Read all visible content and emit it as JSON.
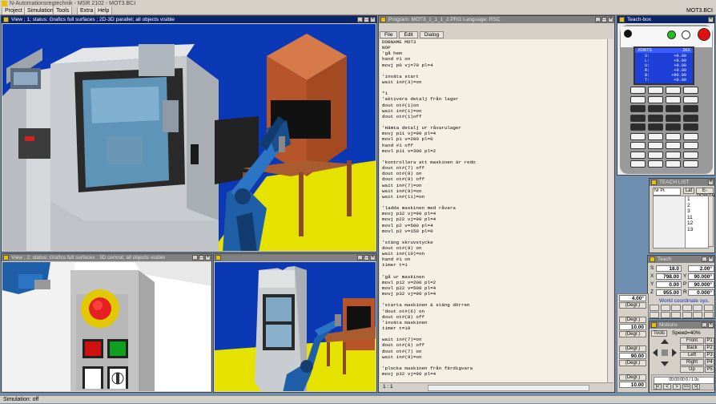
{
  "app": {
    "title": "N-Automationsregtechnik - MSR 2102 - MOT3.BCI",
    "title_right": "MOT3.BCI",
    "menu": [
      "Project",
      "Simulation",
      "Tools",
      "Extra",
      "Help"
    ],
    "menu_right": "MOT3.BCI"
  },
  "view1": {
    "title": "View  ; 1;  status: Grafics   full surfaces ; 2D-3D parallel; all objects visible"
  },
  "view2": {
    "title": "View  ; 2;  status: Grafics   full surfaces ; 3D central; all objects visible"
  },
  "view3": {
    "title": ""
  },
  "program": {
    "title": "Program: MOT3_1_1_1_2.PRG Language: RSC",
    "tabs": [
      "File",
      "Edit",
      "Dialog"
    ],
    "lines": [
      "DOBNAME MOT3",
      "NOP",
      "'gå hem",
      "hand #1 on",
      "movj p0 vj=70 pl=4",
      "",
      "'inväta start",
      "wait in#(3)=on",
      "",
      "*1",
      "'aktivera detalj från lager",
      "dout ot#(1)on",
      "wait in#(1)=on",
      "dout ot#(1)off",
      "",
      "'Hämta detalj ur råvarulager",
      "movj p11 vj=90 pl=4",
      "movl p1 v=200 pl=0",
      "hand #1 off",
      "movl p11 v=300 pl=2",
      "",
      "'kontrollera att maskinen är redo",
      "dout ot#(7) off",
      "dout ot#(8) on",
      "dout ot#(9) off",
      "wait in#(7)=on",
      "wait in#(9)=on",
      "wait in#(11)=on",
      "",
      "'ladda maskinen med råvara",
      "movj p32 vj=90 pl=4",
      "movj p22 vj=90 pl=4",
      "movl p2 v=500 pl=4",
      "movl p2 v=150 pl=0",
      "",
      "'stäng skruvstycke",
      "dout ot#(9) on",
      "wait in#(10)=on",
      "hand #1 on",
      "timer t=1",
      "",
      "'gå ur maskinen",
      "movl p12 v=200 pl=2",
      "movl p22 v=500 pl=4",
      "movj p32 vj=90 pl=4",
      "",
      "'starta maskinen & stäng dörren",
      "'dout ot#(6) on",
      "dout ot#(8) off",
      "'inväta maskinen",
      "timer t=10",
      "",
      "wait in#(7)=on",
      "dout ot#(6) off",
      "dout ot#(7) on",
      "wait in#(9)=on",
      "",
      "'plocka maskinen från färdigvara",
      "movj p32 vj=90 pl=4"
    ],
    "status": "1 : 1"
  },
  "teach_box": {
    "title": "Teach-box",
    "screen_title": "JOINTS",
    "screen_mode": "2KX",
    "axes": [
      {
        "name": "S:",
        "value": "+0.00"
      },
      {
        "name": "L:",
        "value": "+0.00"
      },
      {
        "name": "U:",
        "value": "+0.00"
      },
      {
        "name": "R:",
        "value": "+0.00"
      },
      {
        "name": "B:",
        "value": "+90.00"
      },
      {
        "name": "T:",
        "value": "+0.00"
      }
    ]
  },
  "teach_list": {
    "title": "TEACH LIST",
    "header": "Nr  Pt",
    "button_label": "Lat",
    "button2_label": "E-POINTR",
    "items": [
      "",
      "1",
      "2",
      "3",
      "11",
      "12",
      "13"
    ]
  },
  "pos_panel": {
    "title": "Teach",
    "rows": [
      {
        "a_label": "S",
        "a_val": "18.0",
        "b_label": "",
        "b_val": "2.00°"
      },
      {
        "a_label": "X",
        "a_val": "798.00",
        "b_label": "Y",
        "b_val": "90.000°"
      },
      {
        "a_label": "Y",
        "a_val": "0.00",
        "b_label": "P",
        "b_val": "90.000°"
      },
      {
        "a_label": "Z",
        "a_val": "955.00",
        "b_label": "R",
        "b_val": "0.000°"
      }
    ],
    "coord_label": "World coordinate sys."
  },
  "speed_panel": {
    "title": "Motions",
    "tools_label": "Tools",
    "speed_label": "Speed=40%",
    "dir_buttons": [
      "Front",
      "Back",
      "Left",
      "Right",
      "Up"
    ],
    "p_buttons": [
      "P1",
      "P2",
      "P3",
      "P4",
      "P5"
    ]
  },
  "degree_col": {
    "top_value": "4.00°",
    "labels": [
      "(Degr.)",
      "(Degr.)",
      "(Degr.)",
      "(Degr.)",
      "(Degr.)",
      "(Degr.)"
    ],
    "values": [
      "10.00",
      "90.00",
      "10.00",
      "90.00"
    ],
    "time": "00:00:00:0 / 1.0s"
  },
  "status": {
    "text": "Simulation: off"
  },
  "colors": {
    "title_active": "#0a246a",
    "viewport_floor": "#e6e200",
    "robot": "#1f5fa8"
  }
}
